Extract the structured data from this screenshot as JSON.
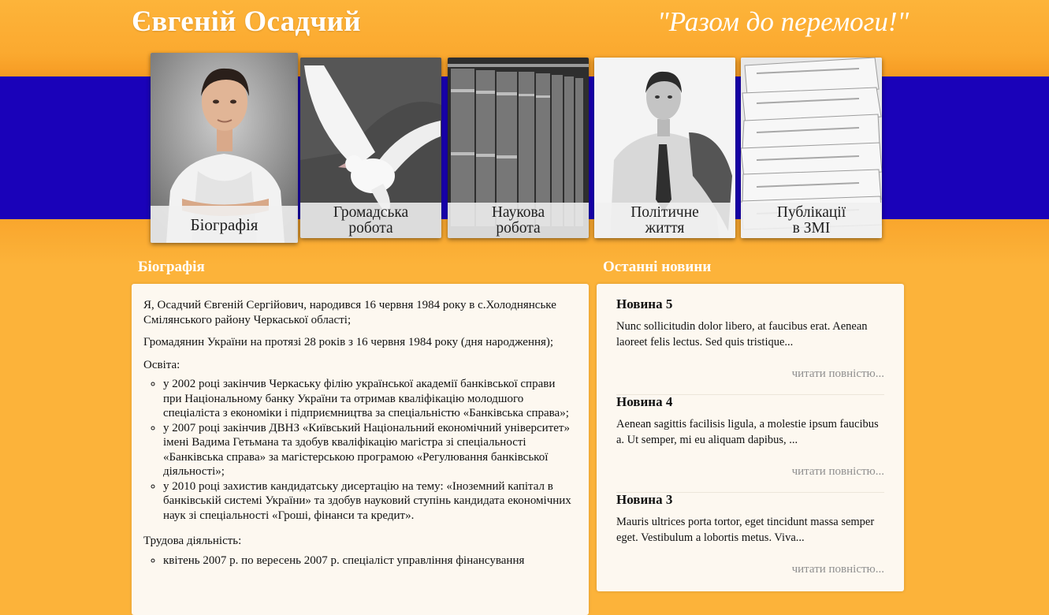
{
  "header": {
    "title": "Євгеній Осадчий",
    "slogan": "\"Разом до перемоги!\""
  },
  "nav": {
    "tiles": [
      {
        "label": "Біографія",
        "active": true,
        "photo": "portrait-man-white-shirt"
      },
      {
        "label": "Громадська\nробота",
        "active": false,
        "photo": "white-dove"
      },
      {
        "label": "Наукова\nробота",
        "active": false,
        "photo": "old-books-shelf"
      },
      {
        "label": "Політичне\nжиття",
        "active": false,
        "photo": "man-with-jacket-over-shoulder"
      },
      {
        "label": "Публікації\nв ЗМІ",
        "active": false,
        "photo": "stack-of-newspapers"
      }
    ]
  },
  "bio": {
    "heading": "Біографія",
    "intro": "Я, Осадчий Євгеній Сергійович, народився 16 червня 1984 року в с.Холоднянське Смілянського району Черкаської області;",
    "citizenship": "Громадянин України на протязі 28 років з 16 червня 1984 року (дня народження);",
    "education_title": "Освіта:",
    "education": [
      "у 2002 році закінчив Черкаську філію української академії банківської справи при Національному банку України та отримав кваліфікацію молодшого спеціаліста з економіки і підприємництва за спеціальністю «Банківська справа»;",
      "у 2007 році закінчив ДВНЗ «Київський Національний економічний університет» імені Вадима Гетьмана та здобув кваліфікацію магістра зі спеціальності «Банківська справа» за магістерською програмою «Регулювання банківської діяльності»;",
      "у 2010 році захистив кандидатську дисертацію на тему: «Іноземний капітал в банківській системі України» та здобув науковий ступінь кандидата економічних наук зі спеціальності «Гроші, фінанси та кредит»."
    ],
    "work_title": "Трудова діяльність:",
    "work": [
      "квітень 2007 р. по вересень 2007 р. спеціаліст управління фінансування"
    ]
  },
  "news": {
    "heading": "Останні новини",
    "items": [
      {
        "title": "Новина 5",
        "excerpt": "Nunc sollicitudin dolor libero, at faucibus erat. Aenean laoreet felis lectus. Sed quis tristique...",
        "more": "читати повністю..."
      },
      {
        "title": "Новина 4",
        "excerpt": "Aenean sagittis facilisis ligula, a molestie ipsum faucibus a. Ut semper, mi eu aliquam dapibus, ...",
        "more": "читати повністю..."
      },
      {
        "title": "Новина 3",
        "excerpt": "Mauris ultrices porta tortor, eget tincidunt massa semper eget. Vestibulum a lobortis metus. Viva...",
        "more": "читати повністю..."
      }
    ]
  },
  "colors": {
    "orange": "#fcb33a",
    "blue_band": "#1a02b9",
    "panel": "#fdf8f0",
    "link_gray": "#8f8f8f"
  }
}
